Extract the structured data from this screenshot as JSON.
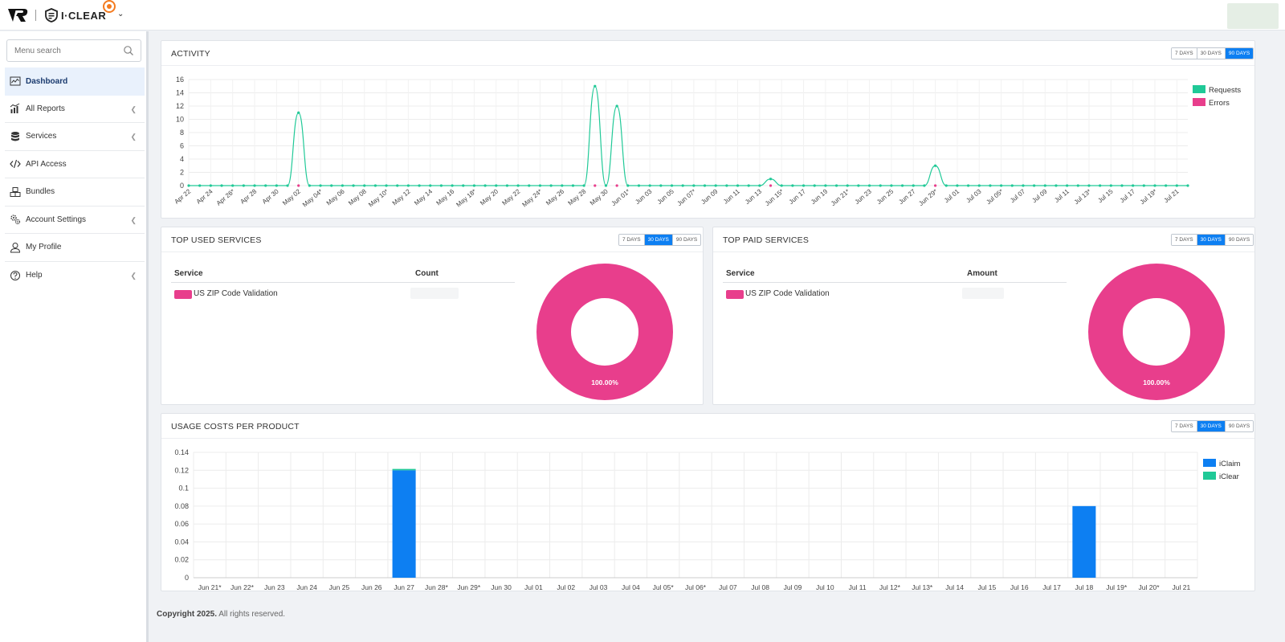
{
  "header": {
    "brand": "I·CLEAR",
    "logo_icon": "vr-logo-icon",
    "chevron_icon": "chevron-down-icon"
  },
  "sidebar": {
    "search_placeholder": "Menu search",
    "items": [
      {
        "label": "Dashboard",
        "icon": "dashboard-icon",
        "active": true,
        "has_submenu": false
      },
      {
        "label": "All Reports",
        "icon": "reports-icon",
        "active": false,
        "has_submenu": true
      },
      {
        "label": "Services",
        "icon": "database-icon",
        "active": false,
        "has_submenu": true
      },
      {
        "label": "API Access",
        "icon": "code-icon",
        "active": false,
        "has_submenu": false
      },
      {
        "label": "Bundles",
        "icon": "bundles-icon",
        "active": false,
        "has_submenu": false
      },
      {
        "label": "Account Settings",
        "icon": "settings-icon",
        "active": false,
        "has_submenu": true
      },
      {
        "label": "My Profile",
        "icon": "user-icon",
        "active": false,
        "has_submenu": false
      },
      {
        "label": "Help",
        "icon": "help-icon",
        "active": false,
        "has_submenu": true
      }
    ]
  },
  "range_buttons": [
    "7 DAYS",
    "30 DAYS",
    "90 DAYS"
  ],
  "activity": {
    "title": "ACTIVITY",
    "selected_range": "90 DAYS"
  },
  "top_used": {
    "title": "TOP USED SERVICES",
    "selected_range": "30 DAYS",
    "col_service": "Service",
    "col_count": "Count",
    "rows": [
      {
        "service": "US ZIP Code Validation"
      }
    ],
    "donut_label": "100.00%"
  },
  "top_paid": {
    "title": "TOP PAID SERVICES",
    "selected_range": "30 DAYS",
    "col_service": "Service",
    "col_amount": "Amount",
    "rows": [
      {
        "service": "US ZIP Code Validation"
      }
    ],
    "donut_label": "100.00%"
  },
  "usage": {
    "title": "USAGE COSTS PER PRODUCT",
    "selected_range": "30 DAYS"
  },
  "footer": {
    "copyright": "Copyright 2025.",
    "rights": "All rights reserved."
  },
  "colors": {
    "requests": "#20c997",
    "errors": "#e83e8c",
    "iclaim": "#0d7ff2",
    "iclear": "#20c997",
    "accent": "#0d7ff2"
  },
  "chart_data": [
    {
      "type": "line",
      "categories": [
        "Apr 22",
        "Apr 24",
        "Apr 26*",
        "Apr 28",
        "Apr 30",
        "May 02",
        "May 04*",
        "May 06",
        "May 08",
        "May 10*",
        "May 12",
        "May 14",
        "May 16",
        "May 18*",
        "May 20",
        "May 22",
        "May 24*",
        "May 26",
        "May 28",
        "May 30",
        "Jun 01*",
        "Jun 03",
        "Jun 05",
        "Jun 07*",
        "Jun 09",
        "Jun 11",
        "Jun 13",
        "Jun 15*",
        "Jun 17",
        "Jun 19",
        "Jun 21*",
        "Jun 23",
        "Jun 25",
        "Jun 27",
        "Jun 29*",
        "Jul 01",
        "Jul 03",
        "Jul 05*",
        "Jul 07",
        "Jul 09",
        "Jul 11",
        "Jul 13*",
        "Jul 15",
        "Jul 17",
        "Jul 19*",
        "Jul 21"
      ],
      "series": [
        {
          "name": "Requests",
          "points": [
            {
              "i": 10,
              "y": 11
            },
            {
              "i": 37,
              "y": 15
            },
            {
              "i": 39,
              "y": 12
            },
            {
              "i": 53,
              "y": 1
            },
            {
              "i": 68,
              "y": 3
            }
          ]
        },
        {
          "name": "Errors",
          "points": []
        }
      ],
      "n_points": 92,
      "yticks": [
        0,
        2,
        4,
        6,
        8,
        10,
        12,
        14,
        16
      ],
      "ylim": [
        0,
        16
      ],
      "legend": "top-right"
    },
    {
      "type": "pie",
      "labels": [
        "US ZIP Code Validation"
      ],
      "values": [
        100
      ],
      "display": "100.00%"
    },
    {
      "type": "pie",
      "labels": [
        "US ZIP Code Validation"
      ],
      "values": [
        100
      ],
      "display": "100.00%"
    },
    {
      "type": "bar",
      "categories": [
        "Jun 21*",
        "Jun 22*",
        "Jun 23",
        "Jun 24",
        "Jun 25",
        "Jun 26",
        "Jun 27",
        "Jun 28*",
        "Jun 29*",
        "Jun 30",
        "Jul 01",
        "Jul 02",
        "Jul 03",
        "Jul 04",
        "Jul 05*",
        "Jul 06*",
        "Jul 07",
        "Jul 08",
        "Jul 09",
        "Jul 10",
        "Jul 11",
        "Jul 12*",
        "Jul 13*",
        "Jul 14",
        "Jul 15",
        "Jul 16",
        "Jul 17",
        "Jul 18",
        "Jul 19*",
        "Jul 20*",
        "Jul 21"
      ],
      "series": [
        {
          "name": "iClaim",
          "values": [
            0,
            0,
            0,
            0,
            0,
            0,
            0.12,
            0,
            0,
            0,
            0,
            0,
            0,
            0,
            0,
            0,
            0,
            0,
            0,
            0,
            0,
            0,
            0,
            0,
            0,
            0,
            0,
            0.08,
            0,
            0,
            0
          ]
        },
        {
          "name": "iClear",
          "values": [
            0,
            0,
            0,
            0,
            0,
            0,
            0.0015,
            0,
            0,
            0,
            0,
            0,
            0,
            0,
            0,
            0,
            0,
            0,
            0,
            0,
            0,
            0,
            0,
            0,
            0,
            0,
            0,
            0,
            0,
            0,
            0
          ]
        }
      ],
      "yticks": [
        0,
        0.02,
        0.04,
        0.06,
        0.08,
        0.1,
        0.12,
        0.14
      ],
      "ylim": [
        0,
        0.14
      ],
      "stacked": true,
      "legend": "top-right"
    }
  ]
}
